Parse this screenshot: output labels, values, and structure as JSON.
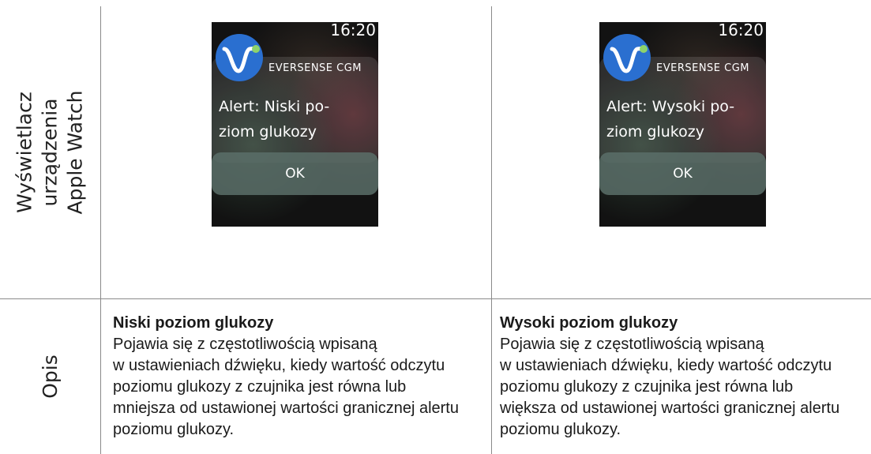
{
  "rows": {
    "display_header": [
      "Wyświetlacz",
      "urządzenia",
      "Apple Watch"
    ],
    "description_header": "Opis"
  },
  "watch_left": {
    "time": "16:20",
    "app_name": "EVERSENSE CGM",
    "message_line1": "Alert: Niski po-",
    "message_line2": "ziom glukozy",
    "button": "OK"
  },
  "watch_right": {
    "time": "16:20",
    "app_name": "EVERSENSE CGM",
    "message_line1": "Alert: Wysoki po-",
    "message_line2": "ziom glukozy",
    "button": "OK"
  },
  "desc_left": {
    "title": "Niski poziom glukozy",
    "lines": [
      "Pojawia się z częstotliwością wpisaną",
      "w ustawieniach dźwięku, kiedy wartość odczytu",
      "poziomu glukozy z czujnika jest równa lub",
      "mniejsza od ustawionej wartości granicznej alertu",
      "poziomu glukozy."
    ]
  },
  "desc_right": {
    "title": "Wysoki poziom glukozy",
    "lines": [
      "Pojawia się z częstotliwością wpisaną",
      "w ustawieniach dźwięku, kiedy wartość odczytu",
      "poziomu glukozy z czujnika jest równa lub",
      "większa od ustawionej wartości granicznej alertu",
      "poziomu glukozy."
    ]
  },
  "colors": {
    "logo_blue": "#2a6fd0",
    "logo_green": "#8ed36b",
    "ok_button": "#5a6e69"
  }
}
